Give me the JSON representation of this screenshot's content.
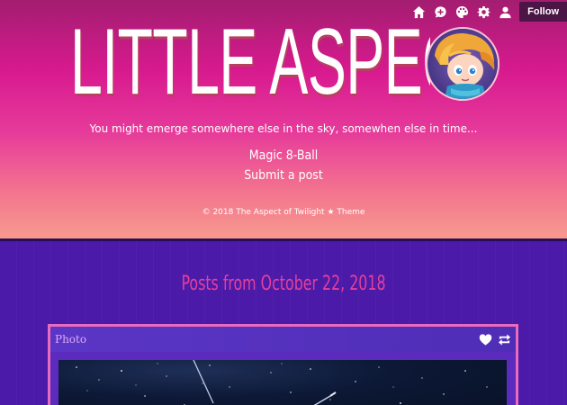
{
  "header": {
    "title": "LITTLE ASPECT",
    "tagline": "You might emerge somewhere else in the sky, somewhen else in time...",
    "nav": [
      "Magic 8-Ball",
      "Submit a post"
    ],
    "credit": "© 2018 The Aspect of Twilight ★ Theme"
  },
  "toolbar": {
    "icons": [
      "home-icon",
      "chat-icon",
      "palette-icon",
      "gear-icon",
      "user-icon"
    ],
    "follow_label": "Follow"
  },
  "main": {
    "archive_title": "Posts from October 22, 2018",
    "post": {
      "type_label": "Photo",
      "actions": [
        "heart-icon",
        "reblog-icon"
      ]
    }
  },
  "colors": {
    "accent": "#e43f9c",
    "header_top": "#a31d70",
    "header_bottom": "#f79a8d",
    "background": "#4c1aa8"
  }
}
